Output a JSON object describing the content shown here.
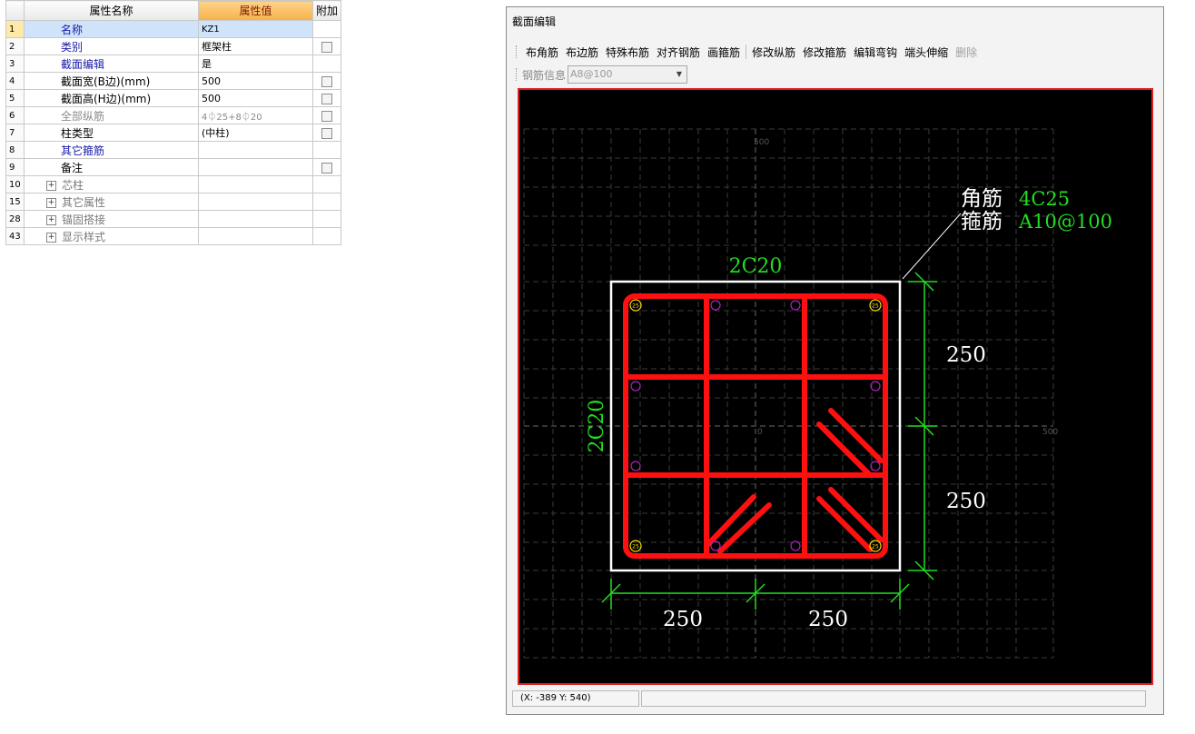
{
  "grid": {
    "headers": {
      "name": "属性名称",
      "value": "属性值",
      "extra": "附加"
    },
    "rows": [
      {
        "num": "1",
        "name": "名称",
        "value": "KZ1",
        "style": "link",
        "selected": true,
        "checkbox": false
      },
      {
        "num": "2",
        "name": "类别",
        "value": "框架柱",
        "style": "link",
        "checkbox": true
      },
      {
        "num": "3",
        "name": "截面编辑",
        "value": "是",
        "style": "link",
        "checkbox": false
      },
      {
        "num": "4",
        "name": "截面宽(B边)(mm)",
        "value": "500",
        "style": "plain",
        "checkbox": true
      },
      {
        "num": "5",
        "name": "截面高(H边)(mm)",
        "value": "500",
        "style": "plain",
        "checkbox": true
      },
      {
        "num": "6",
        "name": "全部纵筋",
        "value": "4⏀25+8⏀20",
        "style": "grey",
        "checkbox": true
      },
      {
        "num": "7",
        "name": "柱类型",
        "value": "(中柱)",
        "style": "plain",
        "checkbox": true
      },
      {
        "num": "8",
        "name": "其它箍筋",
        "value": "",
        "style": "link",
        "checkbox": false
      },
      {
        "num": "9",
        "name": "备注",
        "value": "",
        "style": "plain",
        "checkbox": true
      },
      {
        "num": "10",
        "name": "芯柱",
        "value": "",
        "style": "group",
        "checkbox": false
      },
      {
        "num": "15",
        "name": "其它属性",
        "value": "",
        "style": "group",
        "checkbox": false
      },
      {
        "num": "28",
        "name": "锚固搭接",
        "value": "",
        "style": "group",
        "checkbox": false
      },
      {
        "num": "43",
        "name": "显示样式",
        "value": "",
        "style": "group",
        "checkbox": false
      }
    ]
  },
  "editor": {
    "title": "截面编辑",
    "toolbar": [
      {
        "label": "布角筋",
        "disabled": false
      },
      {
        "label": "布边筋",
        "disabled": false
      },
      {
        "label": "特殊布筋",
        "disabled": false
      },
      {
        "label": "对齐钢筋",
        "disabled": false
      },
      {
        "label": "画箍筋",
        "disabled": false,
        "sep_after": true
      },
      {
        "label": "修改纵筋",
        "disabled": false
      },
      {
        "label": "修改箍筋",
        "disabled": false
      },
      {
        "label": "编辑弯钩",
        "disabled": false
      },
      {
        "label": "端头伸缩",
        "disabled": false
      },
      {
        "label": "删除",
        "disabled": true
      }
    ],
    "rebar_info_label": "钢筋信息",
    "rebar_info_value": "A8@100",
    "status_coords": "(X: -389 Y: 540)"
  },
  "drawing": {
    "grid_label_top": "500",
    "grid_label_center": "0",
    "grid_label_right": "500",
    "corner_label_name": "角筋",
    "corner_label_value": "4C25",
    "stirrup_label_name": "箍筋",
    "stirrup_label_value": "A10@100",
    "top_side_rebar": "2C20",
    "left_side_rebar": "2C20",
    "dim_right_top": "250",
    "dim_right_bottom": "250",
    "dim_bottom_left": "250",
    "dim_bottom_right": "250",
    "corner_bar_mark": "25",
    "colors": {
      "background": "#000000",
      "stirrup": "#ff1010",
      "annotation": "#22dd22",
      "outline": "#ffffff",
      "corner_bar": "#ffe000",
      "side_bar": "#b020c0"
    }
  }
}
